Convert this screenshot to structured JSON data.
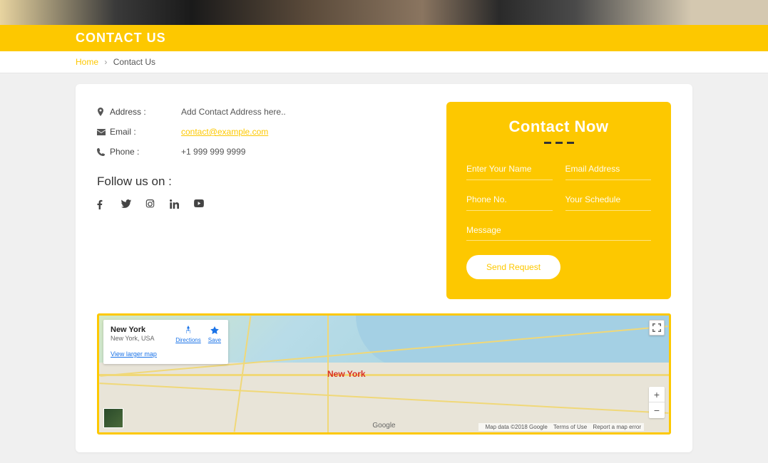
{
  "titleBar": {
    "heading": "CONTACT US"
  },
  "breadcrumb": {
    "home": "Home",
    "current": "Contact Us"
  },
  "contactInfo": {
    "address": {
      "label": "Address :",
      "value": "Add Contact Address here.."
    },
    "email": {
      "label": "Email :",
      "value": "contact@example.com"
    },
    "phone": {
      "label": "Phone :",
      "value": "+1 999 999 9999"
    }
  },
  "followTitle": "Follow us on :",
  "form": {
    "title": "Contact Now",
    "name_ph": "Enter Your Name",
    "email_ph": "Email Address",
    "phone_ph": "Phone No.",
    "schedule_ph": "Your Schedule",
    "message_ph": "Message",
    "submit": "Send Request"
  },
  "map": {
    "card": {
      "title": "New York",
      "subtitle": "New York, USA",
      "directions": "Directions",
      "save": "Save",
      "viewLarger": "View larger map"
    },
    "marker": "New York",
    "attrib": {
      "data": "Map data ©2018 Google",
      "terms": "Terms of Use",
      "report": "Report a map error"
    },
    "google": "Google"
  }
}
